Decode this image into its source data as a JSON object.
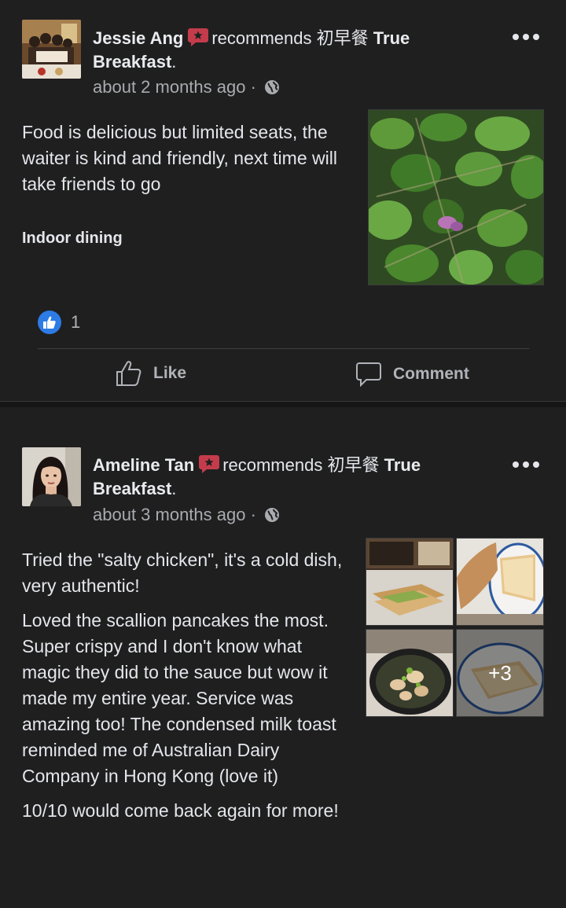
{
  "posts": [
    {
      "author": "Jessie Ang",
      "recommends_text": "recommends",
      "page_name_cn": "初早餐",
      "page_name_en_1": "True",
      "page_name_en_2": "Breakfast",
      "page_period": ".",
      "time": "about 2 months ago",
      "separator": "·",
      "privacy_icon": "globe-icon",
      "text": "Food is delicious but limited seats, the waiter is kind and friendly, next time will take friends to go",
      "tag": "Indoor dining",
      "like_count": "1",
      "actions": {
        "like": "Like",
        "comment": "Comment"
      }
    },
    {
      "author": "Ameline Tan",
      "recommends_text": "recommends",
      "page_name_cn": "初早餐",
      "page_name_en_1": "True",
      "page_name_en_2": "Breakfast",
      "page_period": ".",
      "time": "about 3 months ago",
      "separator": "·",
      "privacy_icon": "globe-icon",
      "paragraphs": [
        "Tried the \"salty chicken\", it's a cold dish, very authentic!",
        "Loved the scallion pancakes the most. Super crispy and I don't know what magic they did to the sauce but wow it made my entire year. Service was amazing too! The condensed milk toast reminded me of Australian Dairy Company in Hong Kong (love it)",
        "10/10 would come back again for more!"
      ],
      "more_photos": "+3"
    }
  ],
  "colors": {
    "background": "#1f1f20",
    "text": "#e4e6eb",
    "muted": "#a8abaf",
    "like_blue": "#2d7be5",
    "recommend_red": "#c43c4b"
  }
}
